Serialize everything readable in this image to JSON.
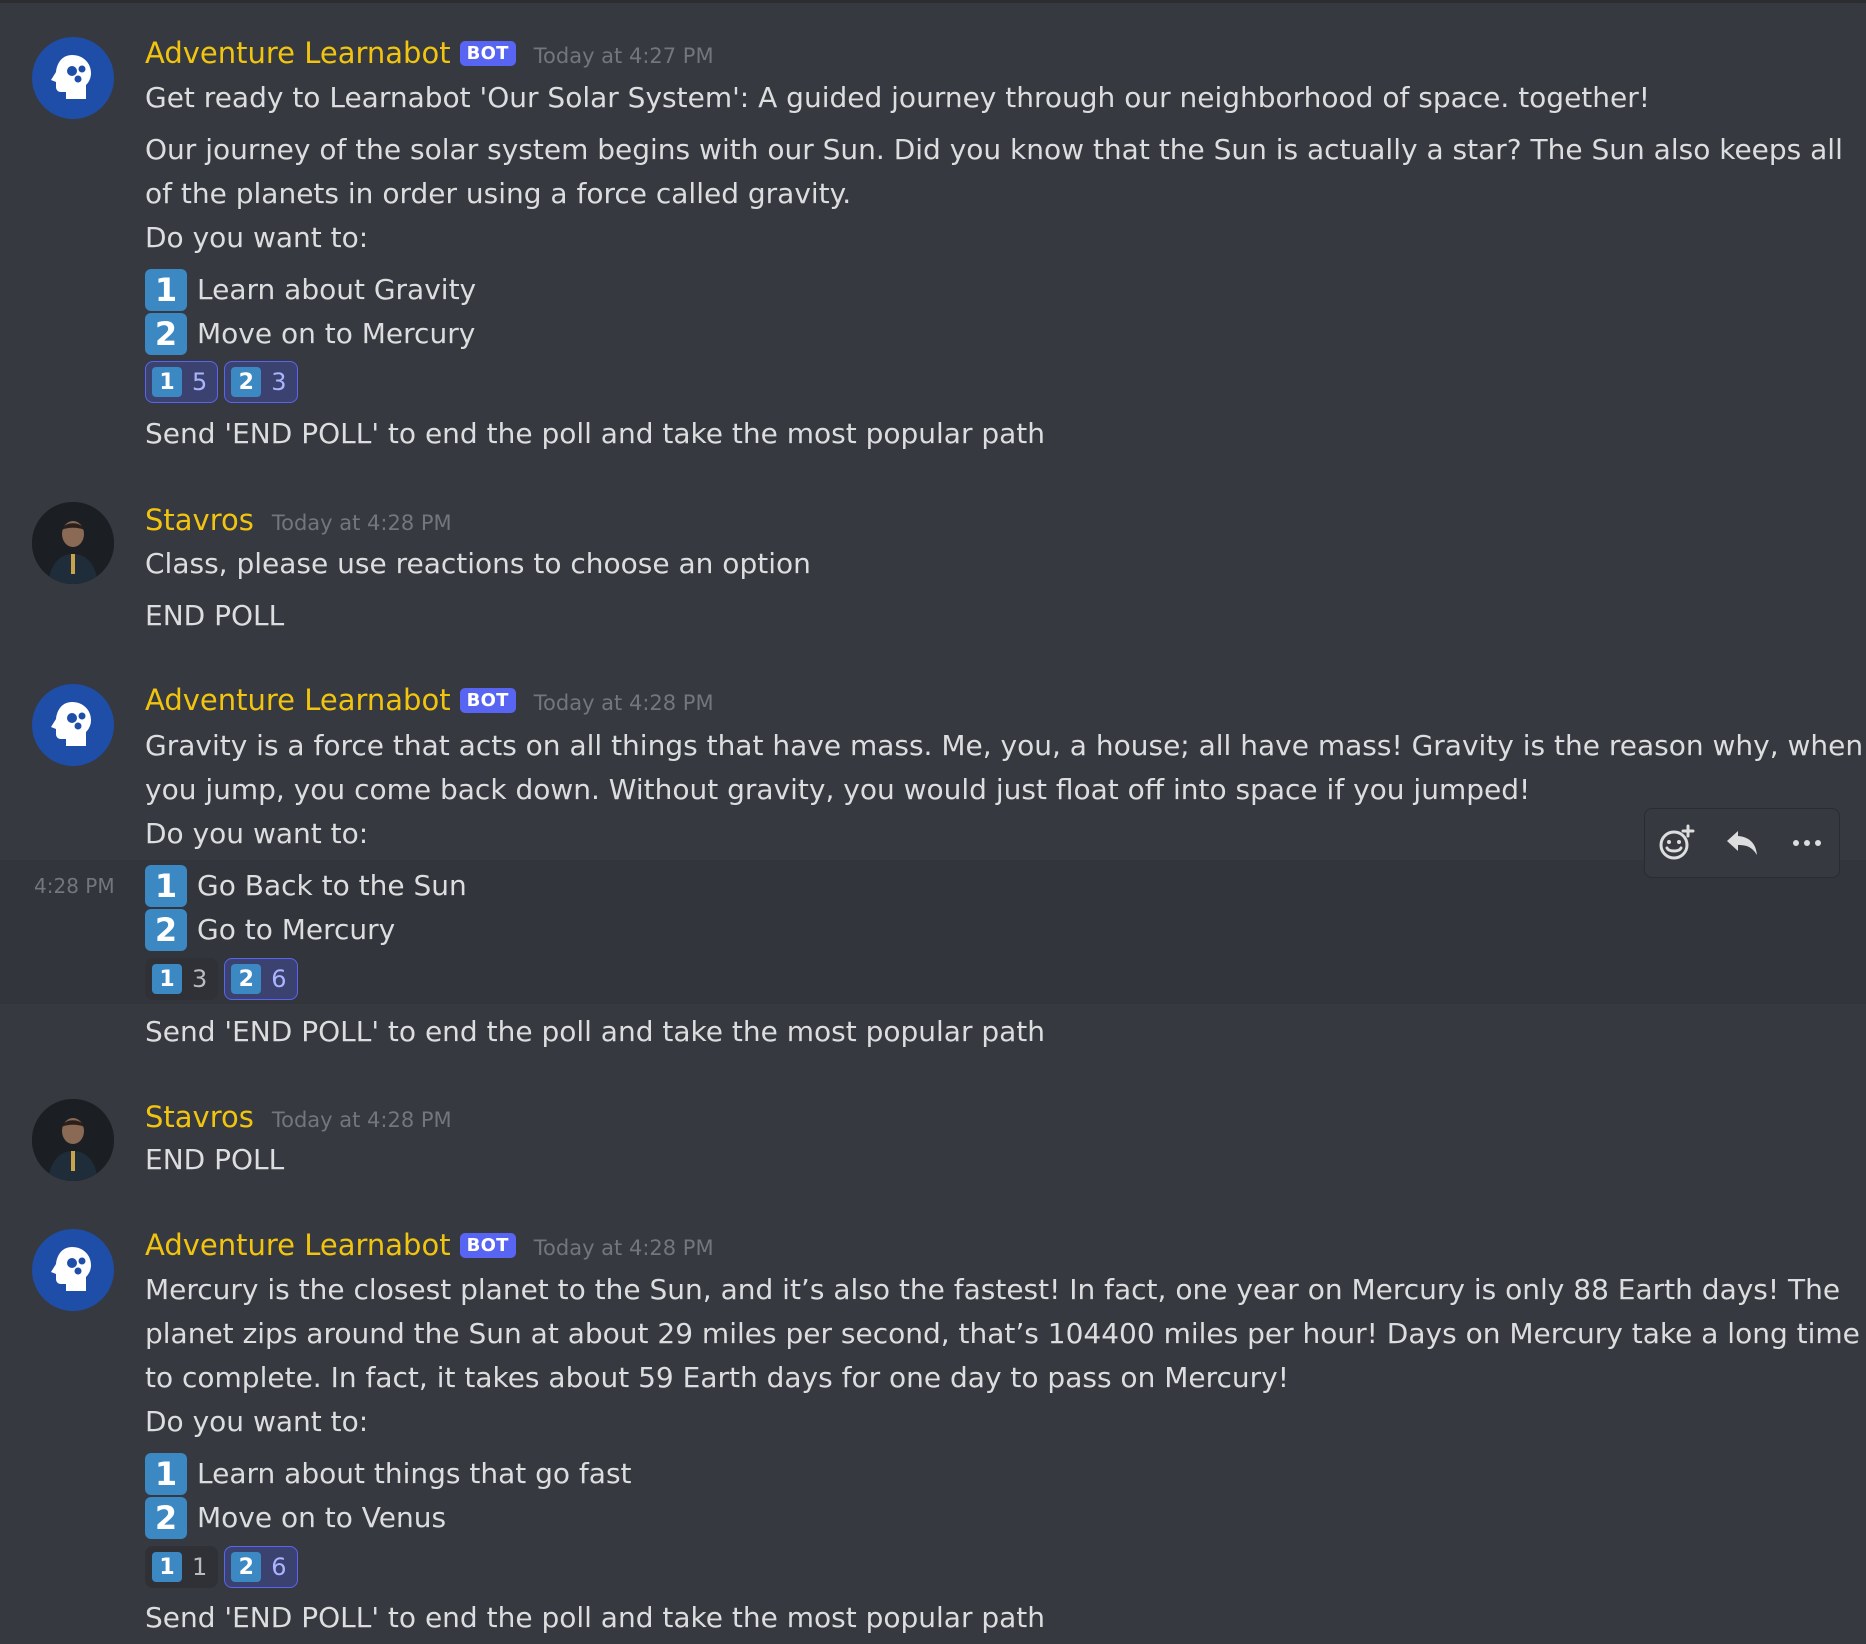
{
  "messages": [
    {
      "author": "Adventure Learnabot",
      "bot_tag": "BOT",
      "timestamp": "Today at 4:27 PM",
      "intro": "Get ready to Learnabot 'Our Solar System': A guided journey through our neighborhood of space. together!",
      "body": [
        "Our journey of the solar system begins with our Sun. Did you know that the Sun is actually a star? The Sun also keeps all",
        "of the planets in order using a force called gravity."
      ],
      "prompt": "Do you want to:",
      "options": [
        {
          "key": "1",
          "label": "Learn about Gravity"
        },
        {
          "key": "2",
          "label": "Move on to Mercury"
        }
      ],
      "reactions": [
        {
          "key": "1",
          "count": "5",
          "me": true
        },
        {
          "key": "2",
          "count": "3",
          "me": true
        }
      ],
      "footer": "Send 'END POLL' to end the poll and take the most popular path"
    },
    {
      "author": "Stavros",
      "timestamp": "Today at 4:28 PM",
      "lines": [
        "Class, please use reactions to choose an option",
        "END POLL"
      ]
    },
    {
      "author": "Adventure Learnabot",
      "bot_tag": "BOT",
      "timestamp": "Today at 4:28 PM",
      "body": [
        "Gravity is a force that acts on all things that have mass. Me, you, a house; all have mass! Gravity is the reason why, when",
        "you jump, you come back down. Without gravity, you would just float off into space if you jumped!"
      ],
      "prompt": "Do you want to:",
      "hover_time": "4:28 PM",
      "options": [
        {
          "key": "1",
          "label": "Go Back to the Sun"
        },
        {
          "key": "2",
          "label": "Go to Mercury"
        }
      ],
      "reactions": [
        {
          "key": "1",
          "count": "3",
          "me": false
        },
        {
          "key": "2",
          "count": "6",
          "me": true
        }
      ],
      "footer": "Send 'END POLL' to end the poll and take the most popular path"
    },
    {
      "author": "Stavros",
      "timestamp": "Today at 4:28 PM",
      "lines": [
        "END POLL"
      ]
    },
    {
      "author": "Adventure Learnabot",
      "bot_tag": "BOT",
      "timestamp": "Today at 4:28 PM",
      "body": [
        "Mercury is the closest planet to the Sun, and it’s also the fastest! In fact, one year on Mercury is only 88 Earth days! The",
        "planet zips around the Sun at about 29 miles per second, that’s 104400 miles per hour! Days on Mercury take a long time",
        "to complete. In fact, it takes about 59 Earth days for one day to pass on Mercury!"
      ],
      "prompt": "Do you want to:",
      "options": [
        {
          "key": "1",
          "label": "Learn about things that go fast"
        },
        {
          "key": "2",
          "label": "Move on to Venus"
        }
      ],
      "reactions": [
        {
          "key": "1",
          "count": "1",
          "me": false
        },
        {
          "key": "2",
          "count": "6",
          "me": true
        }
      ],
      "footer": "Send 'END POLL' to end the poll and take the most popular path"
    }
  ],
  "toolbar": {
    "add_reaction_icon": "add-reaction-icon",
    "reply_icon": "reply-icon",
    "more_icon": "more-icon"
  },
  "colors": {
    "background": "#36393f",
    "username": "#f1c40f",
    "bot_tag": "#5865f2",
    "keycap": "#3b88c3",
    "timestamp": "#72767d"
  }
}
